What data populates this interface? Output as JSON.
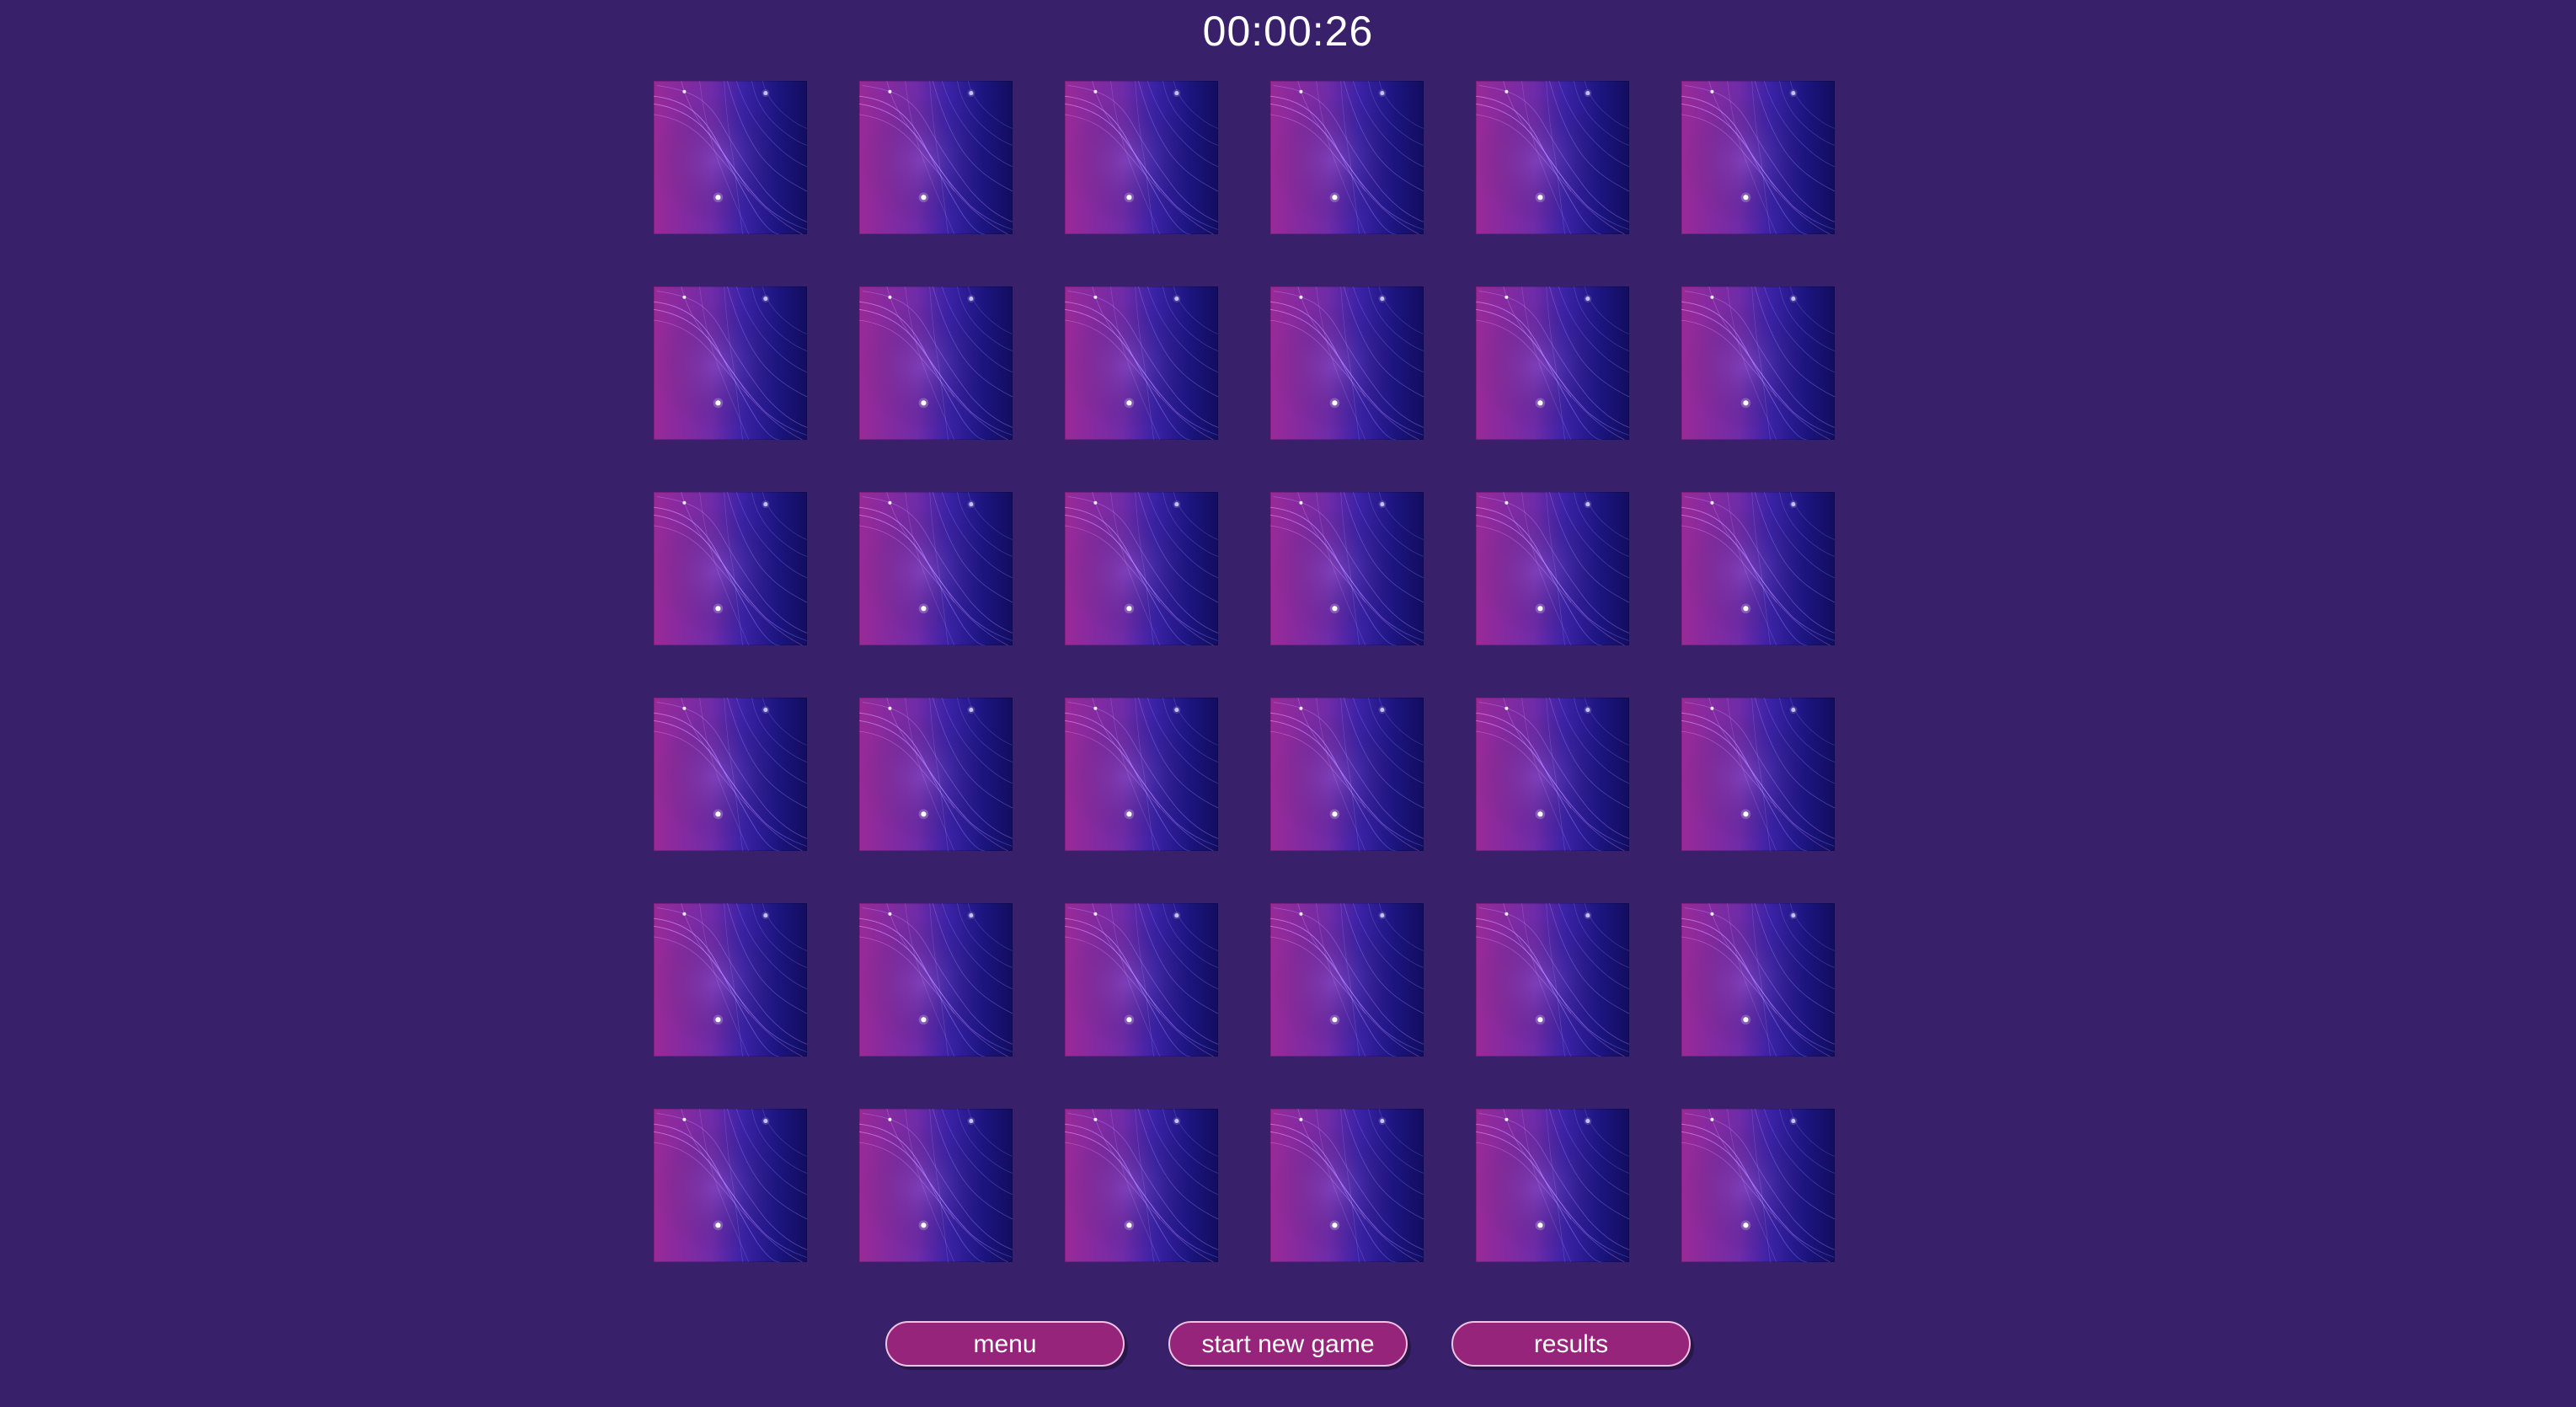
{
  "timer": "00:00:26",
  "board": {
    "rows": 6,
    "columns": 6,
    "card_state": "face-down",
    "card_back_icon": "abstract-wave-card-back-icon",
    "colors": {
      "background": "#39206a",
      "card_left": "#9a2a98",
      "card_right": "#120d5f",
      "button_fill": "#96247a",
      "button_border": "#efc3e3"
    }
  },
  "buttons": {
    "menu": "menu",
    "start_new_game": "start new game",
    "results": "results"
  }
}
